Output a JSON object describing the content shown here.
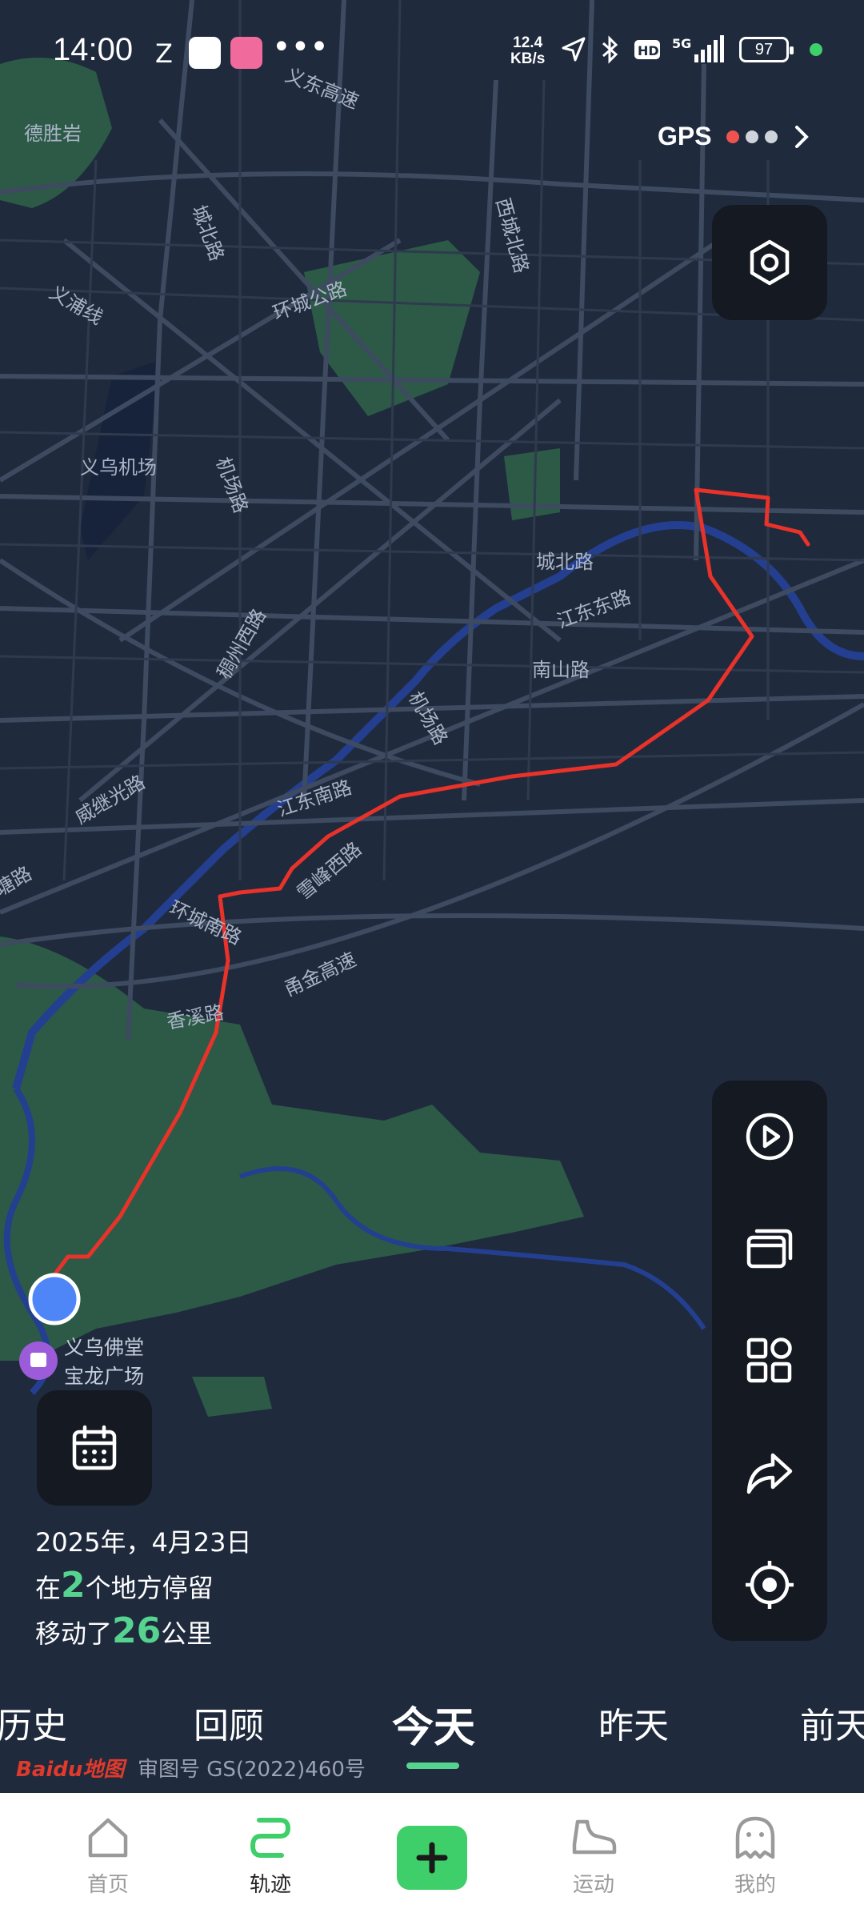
{
  "status_bar": {
    "time": "14:00",
    "net_speed_value": "12.4",
    "net_speed_unit": "KB/s",
    "network": "5G",
    "battery": "97"
  },
  "map": {
    "labels": [
      "义东高速",
      "德胜岩",
      "西城北路",
      "城北路",
      "义浦线",
      "环城公路",
      "义乌机场",
      "机场路",
      "城北路",
      "江东东路",
      "南山路",
      "稠州西路",
      "机场路",
      "威继光路",
      "江东南路",
      "塘路",
      "环城南路",
      "雪峰西路",
      "甬金高速",
      "香溪路",
      "义乌佛堂",
      "宝龙广场"
    ],
    "route_color": "#e8322a",
    "start_point_color": "#4f86f7"
  },
  "gps": {
    "label": "GPS",
    "dot_colors": [
      "#ef5350",
      "#cfd3da",
      "#cfd3da"
    ]
  },
  "toolbar": {
    "settings_icon": "hexagon-settings-icon",
    "tools": [
      "play-icon",
      "cards-icon",
      "grid-icon",
      "share-icon",
      "locate-icon"
    ]
  },
  "summary": {
    "date": "2025年，4月23日",
    "stay_prefix": "在",
    "stay_count": "2",
    "stay_suffix": "个地方停留",
    "move_prefix": "移动了",
    "distance": "26",
    "distance_unit": "公里"
  },
  "tabs": [
    "历史",
    "回顾",
    "今天",
    "昨天",
    "前天"
  ],
  "active_tab": "今天",
  "baidu": {
    "logo": "Baidu地图",
    "license": "审图号 GS(2022)460号"
  },
  "nav": {
    "items": [
      "首页",
      "轨迹",
      "运动",
      "我的"
    ]
  },
  "colors": {
    "accent": "#56d48f",
    "map_bg": "#1f2a3d",
    "panel_bg": "#141922"
  }
}
